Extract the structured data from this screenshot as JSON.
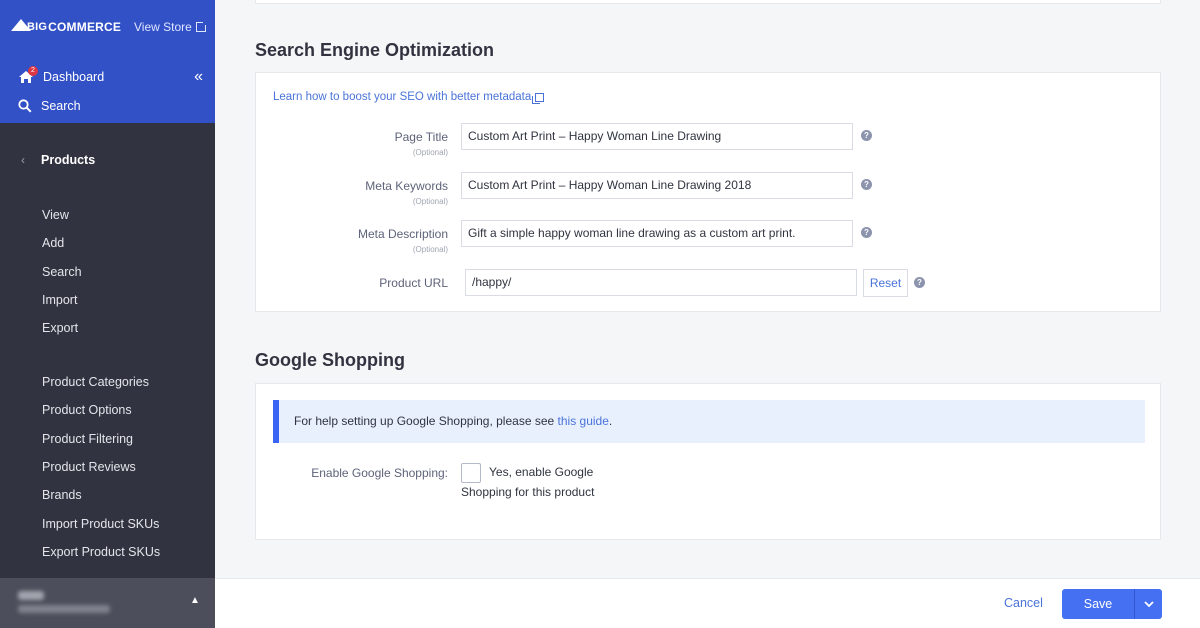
{
  "sidebar": {
    "logo_big": "BIG",
    "logo_rest": "COMMERCE",
    "view_store": "View Store",
    "dashboard": "Dashboard",
    "dashboard_badge": "2",
    "search": "Search",
    "section": "Products",
    "links_group1": [
      "View",
      "Add",
      "Search",
      "Import",
      "Export"
    ],
    "links_group2": [
      "Product Categories",
      "Product Options",
      "Product Filtering",
      "Product Reviews",
      "Brands",
      "Import Product SKUs",
      "Export Product SKUs"
    ]
  },
  "seo": {
    "title": "Search Engine Optimization",
    "learn_link": "Learn how to boost your SEO with better metadata",
    "optional": "(Optional)",
    "page_title_label": "Page Title",
    "page_title_value": "Custom Art Print – Happy Woman Line Drawing",
    "meta_keywords_label": "Meta Keywords",
    "meta_keywords_value": "Custom Art Print – Happy Woman Line Drawing 2018",
    "meta_description_label": "Meta Description",
    "meta_description_value": "Gift a simple happy woman line drawing as a custom art print.",
    "product_url_label": "Product URL",
    "product_url_value": "/happy/",
    "reset": "Reset",
    "help_glyph": "?"
  },
  "google": {
    "title": "Google Shopping",
    "info_text": "For help setting up Google Shopping, please see ",
    "info_link": "this guide",
    "info_end": ".",
    "enable_label": "Enable Google Shopping:",
    "checkbox_text_1": "Yes, enable Google",
    "checkbox_text_2": "Shopping for this product"
  },
  "footer": {
    "cancel": "Cancel",
    "save": "Save"
  },
  "colors": {
    "sidebar_bg": "#313440",
    "sidebar_top": "#3351c6",
    "primary": "#4470f1",
    "link": "#4a73d9"
  }
}
